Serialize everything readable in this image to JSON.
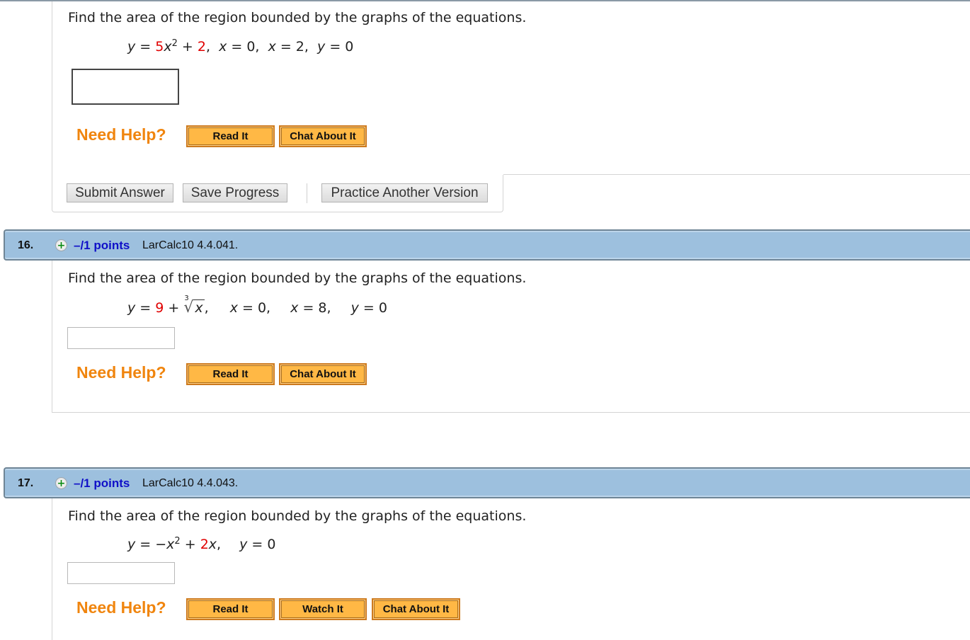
{
  "questions": [
    {
      "prompt": "Find the area of the region bounded by the graphs of the equations.",
      "equation": {
        "y_label": "y",
        "eq_sign": " = ",
        "coef": "5",
        "var": "x",
        "exp": "2",
        "plus": " + ",
        "const": "2",
        "rest_1": ",  ",
        "x0_var": "x",
        "x0_val": " = 0,  ",
        "x2_var": "x",
        "x2_val": " = 2,  ",
        "y0_var": "y",
        "y0_val": " = 0"
      },
      "answer_value": "",
      "need_help": "Need Help?",
      "help_buttons": [
        "Read It",
        "Chat About It"
      ],
      "actions": {
        "submit": "Submit Answer",
        "save": "Save Progress",
        "practice": "Practice Another Version"
      }
    },
    {
      "number": "16.",
      "points": "–/1 points",
      "reference": "LarCalc10 4.4.041.",
      "prompt": "Find the area of the region bounded by the graphs of the equations.",
      "equation": {
        "y_label": "y",
        "eq_sign": " = ",
        "const": "9",
        "plus": " + ",
        "root_index": "3",
        "radicand": "x",
        "rest_1": ",",
        "x0_var": "x",
        "x0_val": " = 0,",
        "x8_var": "x",
        "x8_val": " = 8,",
        "y0_var": "y",
        "y0_val": " = 0"
      },
      "answer_value": "",
      "need_help": "Need Help?",
      "help_buttons": [
        "Read It",
        "Chat About It"
      ]
    },
    {
      "number": "17.",
      "points": "–/1 points",
      "reference": "LarCalc10 4.4.043.",
      "prompt": "Find the area of the region bounded by the graphs of the equations.",
      "equation": {
        "y_label": "y",
        "eq_sign": " = −",
        "var": "x",
        "exp": "2",
        "plus": " + ",
        "coef": "2",
        "var2": "x",
        "rest_1": ",",
        "y0_var": "y",
        "y0_val": " = 0"
      },
      "answer_value": "",
      "need_help": "Need Help?",
      "help_buttons": [
        "Read It",
        "Watch It",
        "Chat About It"
      ]
    }
  ],
  "icons": {
    "expand": "plus-circle-icon"
  },
  "colors": {
    "header_bar": "#9dc0de",
    "points_link": "#1010c8",
    "need_help": "#f0850e",
    "help_button": "#ffb845",
    "equation_highlight": "#e00000"
  }
}
